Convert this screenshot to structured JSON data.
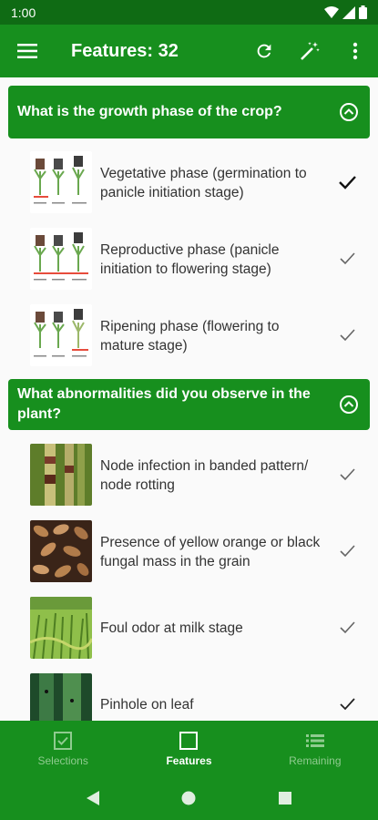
{
  "status_bar": {
    "time": "1:00"
  },
  "app_bar": {
    "title": "Features: 32"
  },
  "sections": [
    {
      "question": "What is the growth phase of the crop?",
      "items": [
        {
          "label": "Vegetative phase (germination to panicle initiation stage)",
          "checked": true
        },
        {
          "label": "Reproductive phase (panicle initiation to flowering stage)",
          "checked": false
        },
        {
          "label": "Ripening phase (flowering to mature stage)",
          "checked": false
        }
      ]
    },
    {
      "question": "What abnormalities did you observe in the plant?",
      "items": [
        {
          "label": "Node infection in banded pattern/ node rotting",
          "checked": false
        },
        {
          "label": "Presence of  yellow orange or black fungal mass in the grain",
          "checked": false
        },
        {
          "label": "Foul odor at milk stage",
          "checked": false
        },
        {
          "label": "Pinhole on leaf",
          "checked": false
        }
      ]
    }
  ],
  "bottom_nav": {
    "tabs": [
      {
        "label": "Selections",
        "icon": "checkbox-icon",
        "active": false
      },
      {
        "label": "Features",
        "icon": "square-icon",
        "active": true
      },
      {
        "label": "Remaining",
        "icon": "list-icon",
        "active": false
      }
    ]
  },
  "colors": {
    "primary": "#178f1e",
    "primary_dark": "#0f6b14",
    "inactive_tab": "#8fcb8f"
  }
}
